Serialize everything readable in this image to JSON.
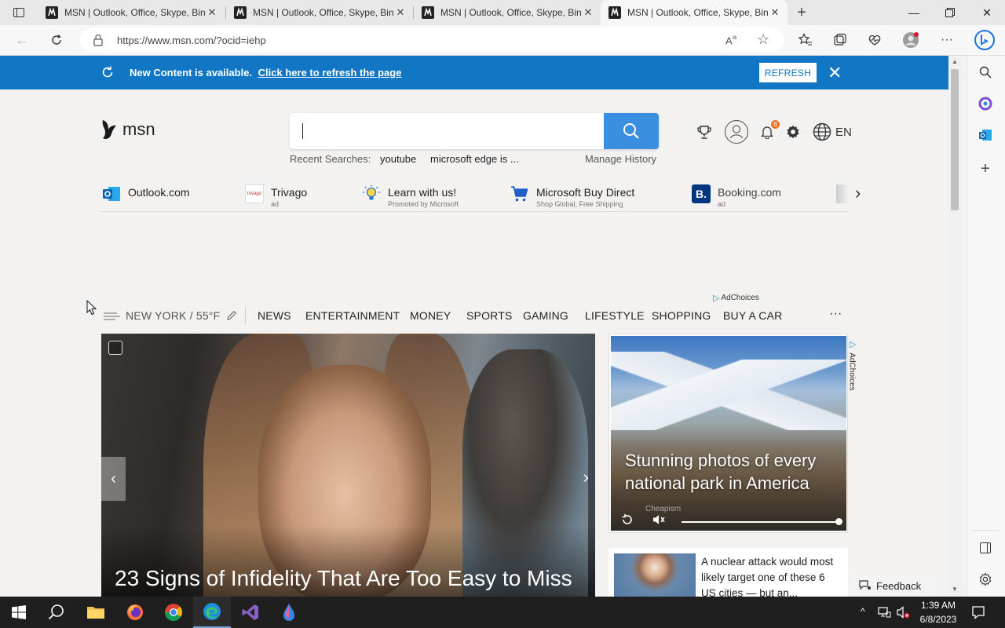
{
  "browser": {
    "tabs": [
      {
        "title": "MSN | Outlook, Office, Skype, Bin"
      },
      {
        "title": "MSN | Outlook, Office, Skype, Bin"
      },
      {
        "title": "MSN | Outlook, Office, Skype, Bin"
      },
      {
        "title": "MSN | Outlook, Office, Skype, Bin",
        "active": true
      }
    ],
    "url": "https://www.msn.com/?ocid=iehp",
    "profile_badge_color": "#e81123"
  },
  "notice": {
    "message": "New Content is available.",
    "link": "Click here to refresh the page",
    "refresh_label": "REFRESH"
  },
  "header": {
    "logo_text": "msn",
    "search_placeholder": "",
    "recent_label": "Recent Searches:",
    "recent": [
      "youtube",
      "microsoft edge is ..."
    ],
    "manage_history": "Manage History",
    "notification_count": "6",
    "language": "EN"
  },
  "quick_links": [
    {
      "label": "Outlook.com",
      "sub": ""
    },
    {
      "label": "Trivago",
      "sub": "ad"
    },
    {
      "label": "Learn with us!",
      "sub": "Promoted by Microsoft"
    },
    {
      "label": "Microsoft Buy Direct",
      "sub": "Shop Global, Free Shipping"
    },
    {
      "label": "Booking.com",
      "sub": "ad"
    }
  ],
  "nav": {
    "weather": "NEW YORK / 55°F",
    "items": [
      "NEWS",
      "ENTERTAINMENT",
      "MONEY",
      "SPORTS",
      "GAMING",
      "LIFESTYLE",
      "SHOPPING",
      "BUY A CAR"
    ],
    "more": "···"
  },
  "adchoices": "AdChoices",
  "hero": {
    "headline": "23 Signs of Infidelity That Are Too Easy to Miss"
  },
  "ad": {
    "caption": "Stunning photos of every national park in America",
    "source": "Cheapism",
    "side_label": "AdChoices",
    "progress": 1.0
  },
  "news": {
    "text": "A nuclear attack would most likely target one of these 6 US cities — but an..."
  },
  "feedback": "Feedback",
  "taskbar": {
    "time": "1:39 AM",
    "date": "6/8/2023"
  }
}
